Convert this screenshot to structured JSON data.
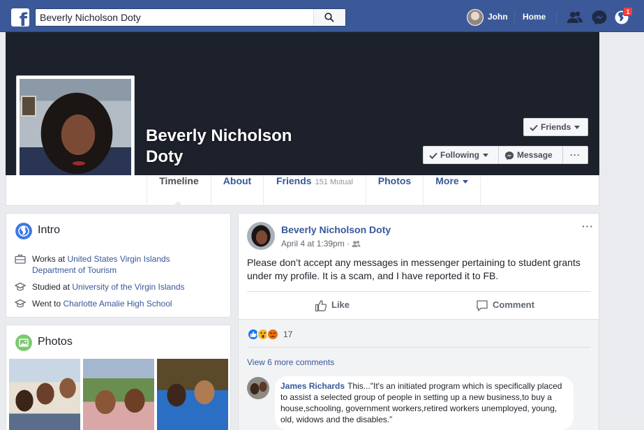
{
  "topbar": {
    "logo_letter": "f",
    "search_value": "Beverly Nicholson Doty",
    "user_name": "John",
    "home_label": "Home",
    "notification_count": "1",
    "brand_color": "#3b5998"
  },
  "profile": {
    "name": "Beverly Nicholson Doty",
    "friends_button": "Friends",
    "following_button": "Following",
    "message_button": "Message",
    "more_button": "···"
  },
  "tabs": [
    {
      "label": "Timeline"
    },
    {
      "label": "About"
    },
    {
      "label": "Friends",
      "sub": "151 Mutual"
    },
    {
      "label": "Photos"
    },
    {
      "label": "More"
    }
  ],
  "intro": {
    "title": "Intro",
    "items": [
      {
        "prefix": "Works at ",
        "link": "United States Virgin Islands Department of Tourism",
        "icon": "briefcase-icon"
      },
      {
        "prefix": "Studied at ",
        "link": "University of the Virgin Islands",
        "icon": "graduation-cap-icon"
      },
      {
        "prefix": "Went to ",
        "link": "Charlotte Amalie High School",
        "icon": "graduation-cap-icon"
      }
    ]
  },
  "photos": {
    "title": "Photos"
  },
  "post": {
    "author": "Beverly Nicholson Doty",
    "time": "April 4 at 1:39pm · ",
    "text": "Please don’t accept any messages in messenger pertaining to student grants under my profile. It is a scam, and I have reported it to FB.",
    "like_label": "Like",
    "comment_label": "Comment",
    "menu": "···",
    "reaction_count": "17",
    "view_more": "View 6 more comments",
    "comment": {
      "author": "James Richards",
      "text": "This...\"It's an initiated program which is specifically placed to assist a selected group of people in setting up a new business,to buy a house,schooling, government workers,retired workers unemployed, young, old, widows and the disables.”"
    }
  }
}
